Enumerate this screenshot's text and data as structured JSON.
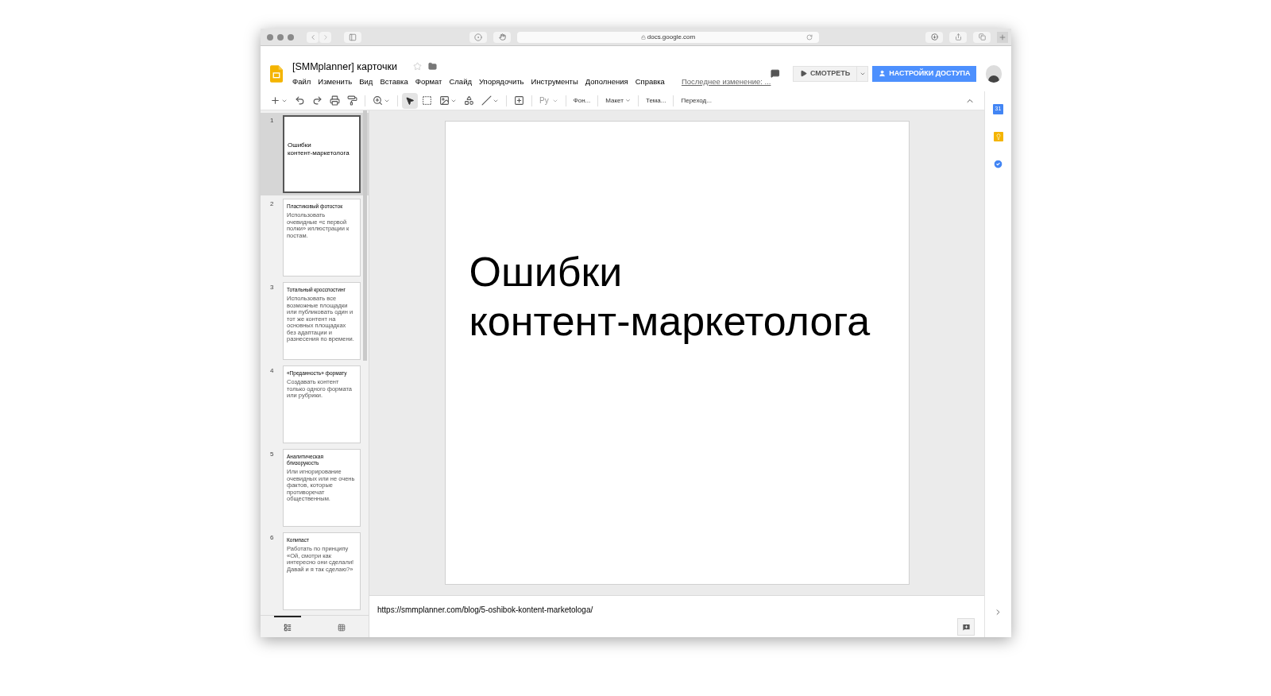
{
  "browser": {
    "url": "docs.google.com"
  },
  "doc": {
    "title": "[SMMplanner] карточки",
    "starred": false
  },
  "menu": [
    "Файл",
    "Изменить",
    "Вид",
    "Вставка",
    "Формат",
    "Слайд",
    "Упорядочить",
    "Инструменты",
    "Дополнения",
    "Справка"
  ],
  "last_edit": "Последнее изменение: ...",
  "present_button": "СМОТРЕТЬ",
  "share_button": "НАСТРОЙКИ ДОСТУПА",
  "toolbar": {
    "input_tool": "Ру",
    "buttons": [
      {
        "label": "Фон...",
        "kind": "text"
      },
      {
        "label": "Макет",
        "kind": "dropdown"
      },
      {
        "label": "Тема...",
        "kind": "text"
      },
      {
        "label": "Переход...",
        "kind": "text"
      }
    ]
  },
  "slides": [
    {
      "number": "1",
      "title": "Ошибки\nконтент-маркетолога",
      "selected": true,
      "kind": "title"
    },
    {
      "number": "2",
      "title": "Пластиковый фотосток",
      "body": "Использовать очевидные «с первой полки» иллюстрации к постам.",
      "selected": false,
      "kind": "content"
    },
    {
      "number": "3",
      "title": "Тотальный кросспостинг",
      "body": "Использовать все возможные площадки или публиковать один и тот же контент на основных площадках без адаптации и разнесения по времени.",
      "selected": false,
      "kind": "content"
    },
    {
      "number": "4",
      "title": "«Преданность» формату",
      "body": "Создавать контент только одного формата или рубрики.",
      "selected": false,
      "kind": "content"
    },
    {
      "number": "5",
      "title": "Аналитическая близорукость",
      "body": "Или игнорирование очевидных или не очень фактов, которые противоречат общественным.",
      "selected": false,
      "kind": "content"
    },
    {
      "number": "6",
      "title": "Копипаст",
      "body": "Работать по принципу «Ой, смотри как интересно они сделали! Давай и я так сделаю?»",
      "selected": false,
      "kind": "content"
    }
  ],
  "views": [
    {
      "kind": "filmstrip",
      "selected": true
    },
    {
      "kind": "grid",
      "selected": false
    }
  ],
  "current_slide": {
    "title_lines": [
      "Ошибки",
      "контент-маркетолога"
    ]
  },
  "notes": "https://smmplanner.com/blog/5-oshibok-kontent-marketologa/",
  "side_panel": {
    "calendar_day": "31"
  }
}
